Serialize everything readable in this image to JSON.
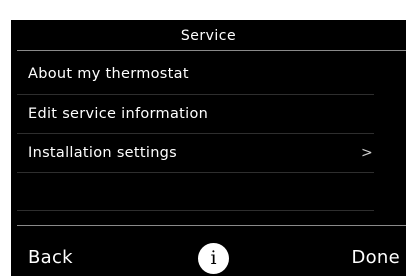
{
  "screen": {
    "title": "Service"
  },
  "menu": {
    "items": [
      {
        "label": "About my thermostat",
        "has_chevron": false
      },
      {
        "label": "Edit service information",
        "has_chevron": false
      },
      {
        "label": "Installation settings",
        "has_chevron": true,
        "chevron_glyph": ">"
      }
    ]
  },
  "footer": {
    "back_label": "Back",
    "info_label": "i",
    "done_label": "Done"
  },
  "colors": {
    "background": "#000000",
    "text": "#ffffff",
    "divider": "#8a8a8a",
    "info_button_bg": "#ffffff"
  },
  "icons": {
    "info": "info-icon",
    "chevron": "chevron-right-icon"
  }
}
